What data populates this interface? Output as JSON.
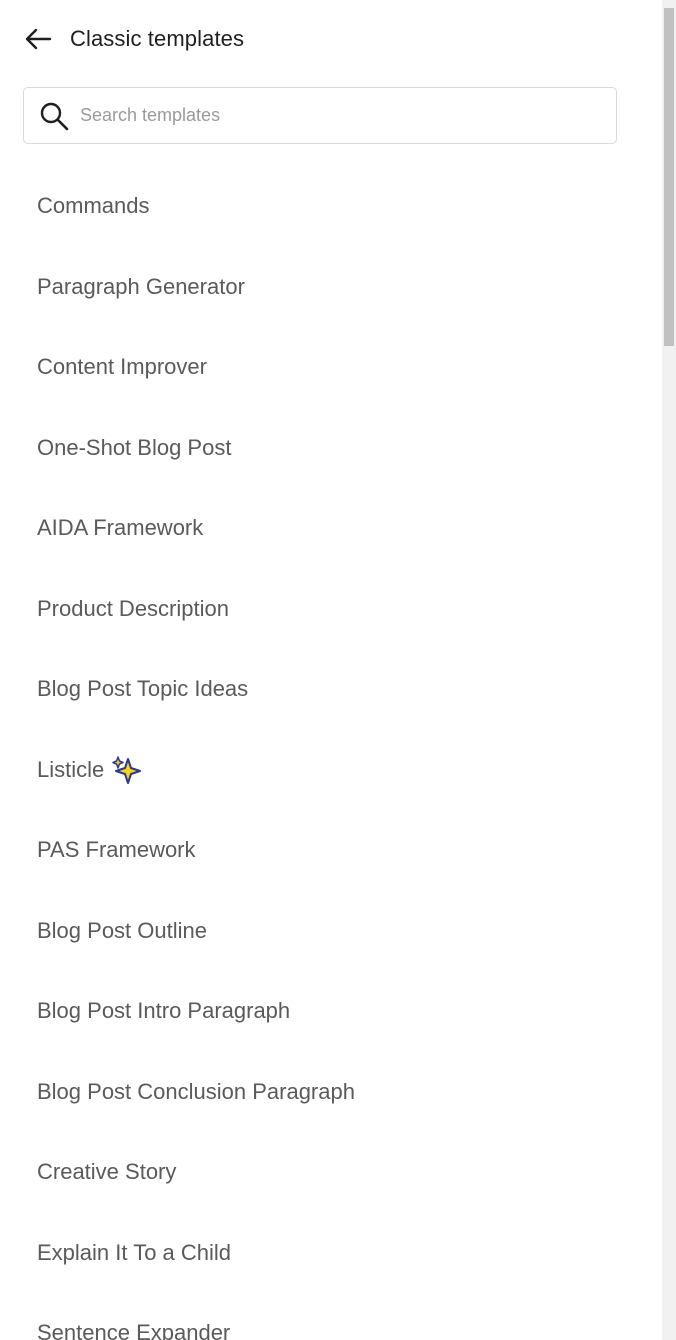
{
  "header": {
    "back_icon": "arrow-left-icon",
    "title": "Classic templates"
  },
  "search": {
    "icon": "search-icon",
    "placeholder": "Search templates",
    "value": ""
  },
  "templates": [
    {
      "label": "Commands"
    },
    {
      "label": "Paragraph Generator"
    },
    {
      "label": "Content Improver"
    },
    {
      "label": "One-Shot Blog Post"
    },
    {
      "label": "AIDA Framework"
    },
    {
      "label": "Product Description"
    },
    {
      "label": "Blog Post Topic Ideas"
    },
    {
      "label": "Listicle",
      "badge_icon": "sparkle-icon"
    },
    {
      "label": "PAS Framework"
    },
    {
      "label": "Blog Post Outline"
    },
    {
      "label": "Blog Post Intro Paragraph"
    },
    {
      "label": "Blog Post Conclusion Paragraph"
    },
    {
      "label": "Creative Story"
    },
    {
      "label": "Explain It To a Child"
    },
    {
      "label": "Sentence Expander"
    }
  ],
  "colors": {
    "title": "#1f1f1f",
    "item_text": "#5a5a5a",
    "placeholder": "#9a9a9a",
    "border": "#d9d9d9",
    "scroll_track": "#f1f1f1",
    "scroll_thumb": "#c1c1c1",
    "sparkle_yellow": "#f7d21f",
    "sparkle_blue": "#2b3a8c"
  }
}
